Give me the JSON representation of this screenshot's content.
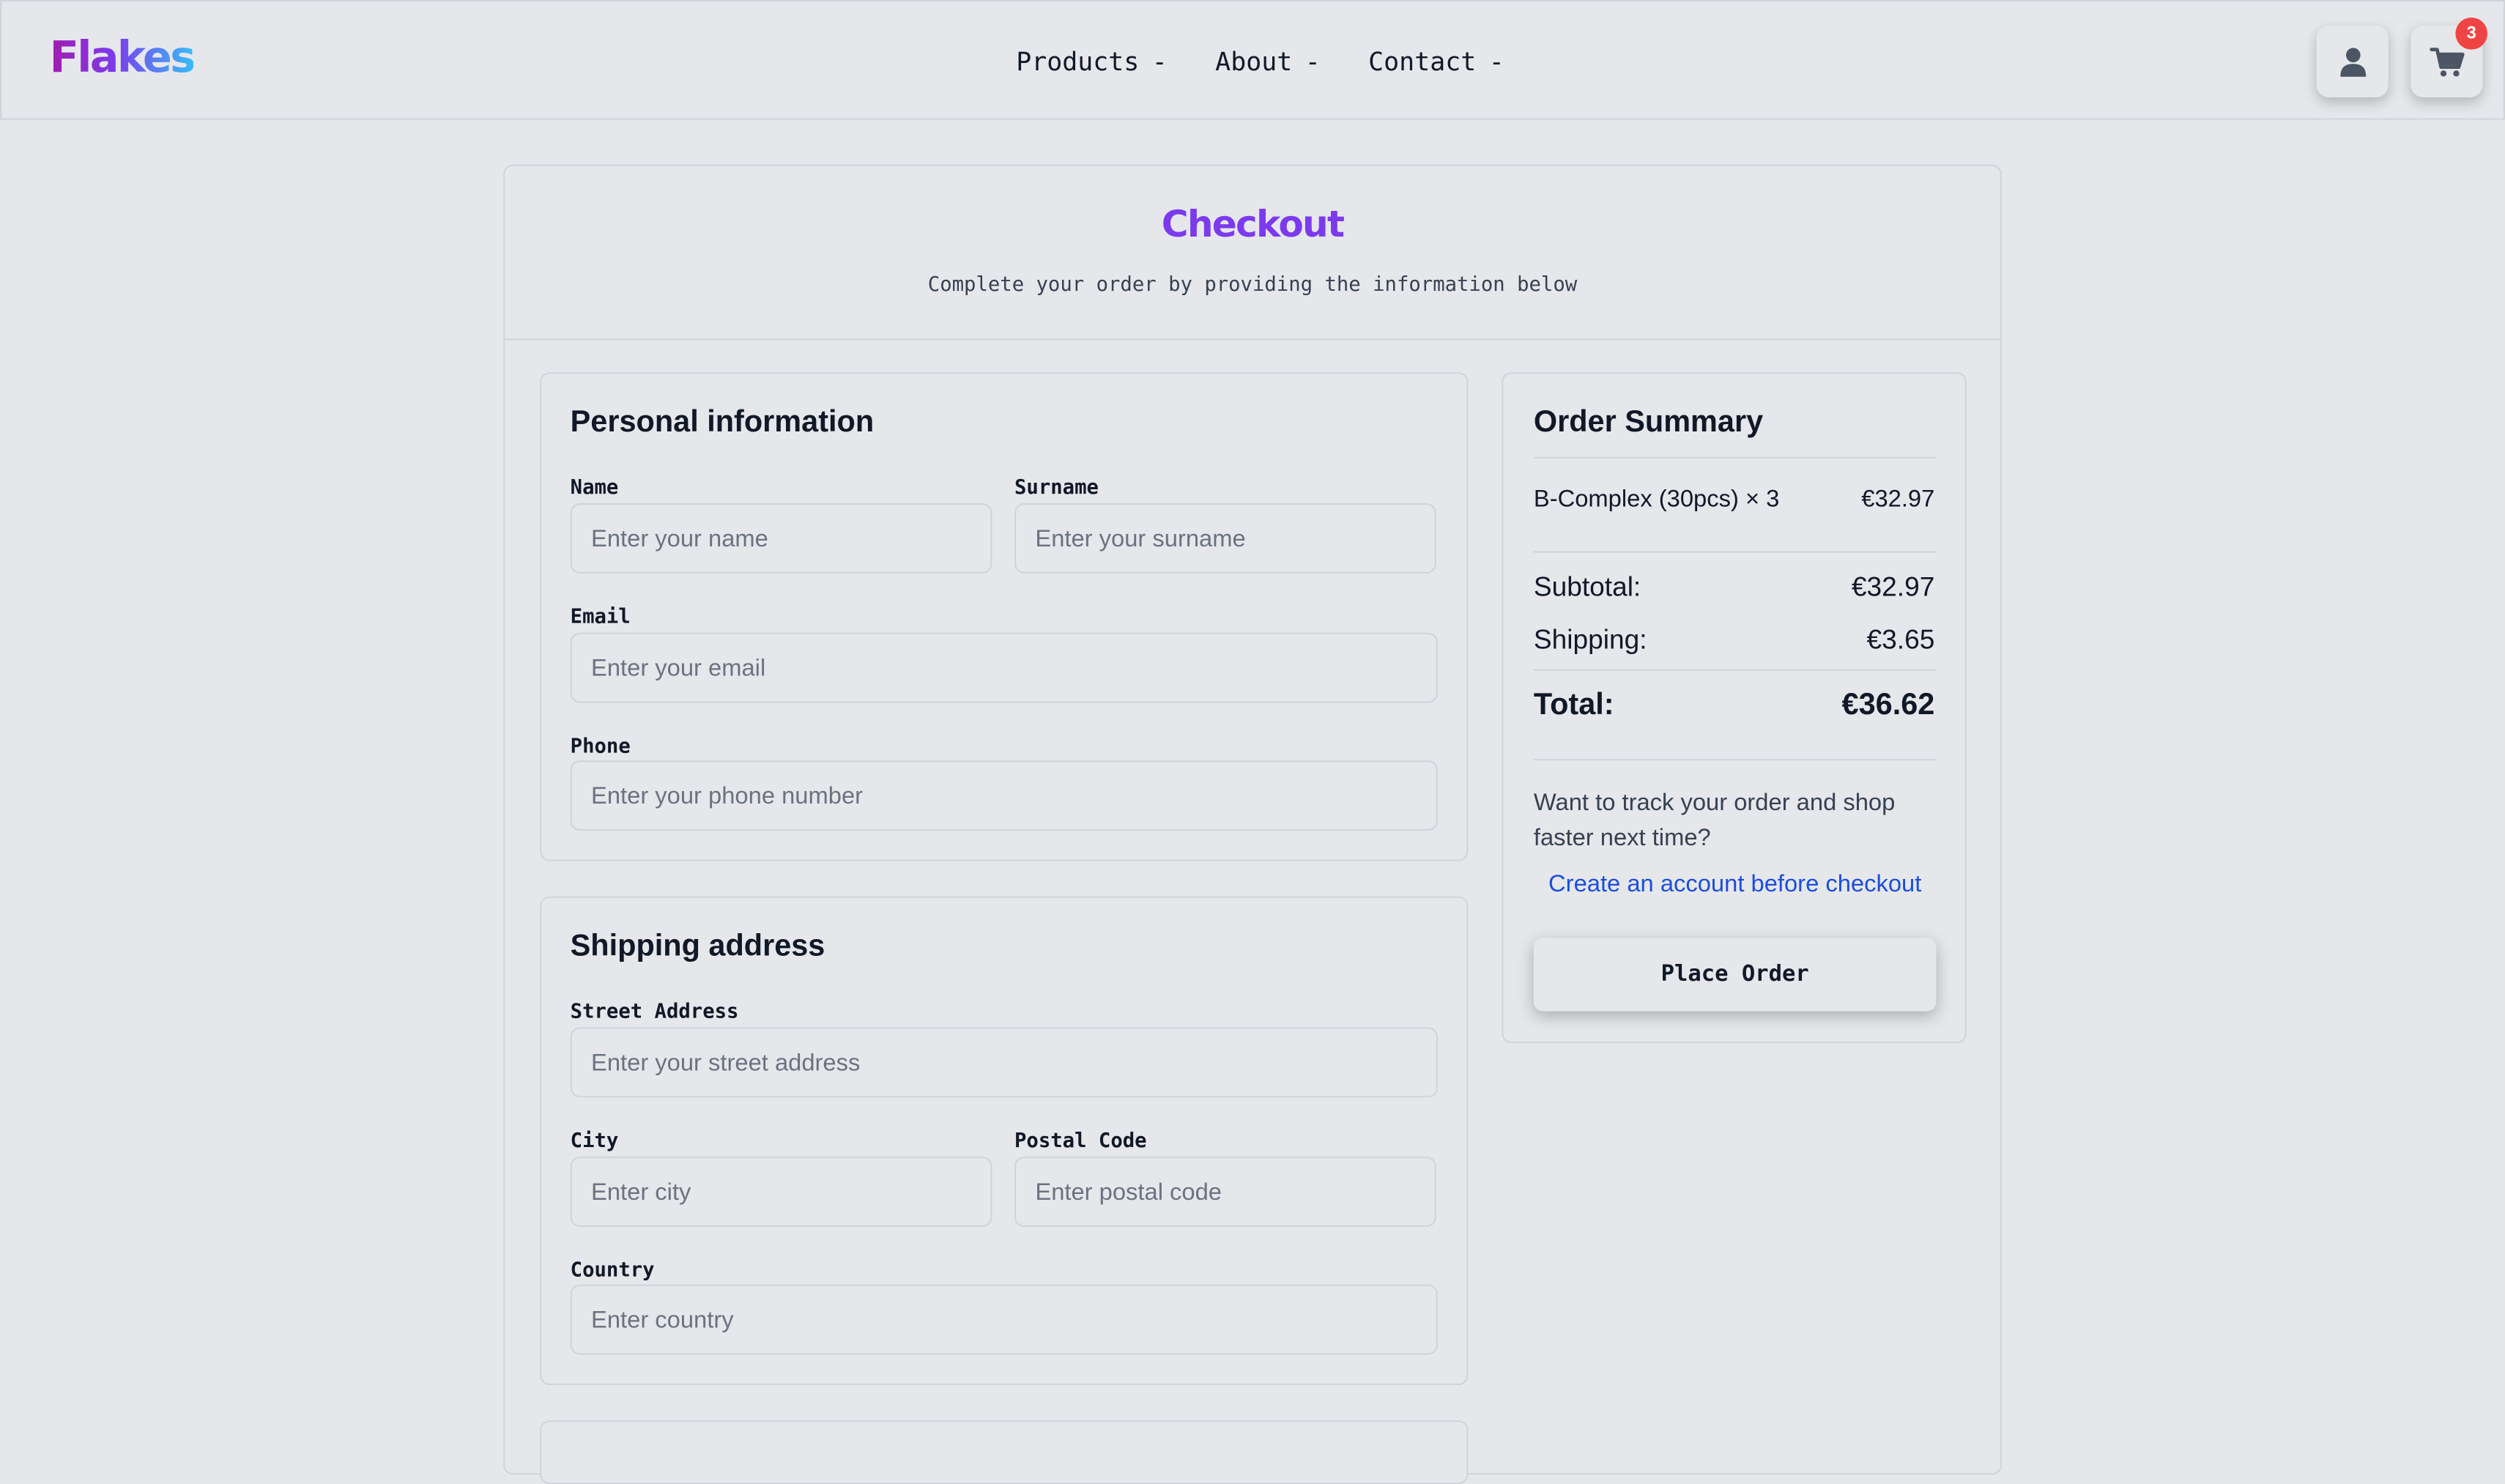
{
  "brand": {
    "logo": "Flakes"
  },
  "nav": {
    "items": [
      {
        "label": "Products",
        "caret": "-"
      },
      {
        "label": "About",
        "caret": "-"
      },
      {
        "label": "Contact",
        "caret": "-"
      }
    ]
  },
  "header_actions": {
    "user_icon": "user-icon",
    "cart_icon": "cart-icon",
    "cart_count": "3"
  },
  "checkout": {
    "title": "Checkout",
    "subtitle": "Complete your order by providing the information below"
  },
  "personal": {
    "title": "Personal information",
    "name_label": "Name",
    "name_placeholder": "Enter your name",
    "surname_label": "Surname",
    "surname_placeholder": "Enter your surname",
    "email_label": "Email",
    "email_placeholder": "Enter your email",
    "phone_label": "Phone",
    "phone_placeholder": "Enter your phone number"
  },
  "shipping": {
    "title": "Shipping address",
    "street_label": "Street Address",
    "street_placeholder": "Enter your street address",
    "city_label": "City",
    "city_placeholder": "Enter city",
    "postal_label": "Postal Code",
    "postal_placeholder": "Enter postal code",
    "country_label": "Country",
    "country_placeholder": "Enter country"
  },
  "summary": {
    "title": "Order Summary",
    "items": [
      {
        "name": "B-Complex (30pcs) × 3",
        "price": "€32.97"
      }
    ],
    "subtotal_label": "Subtotal:",
    "subtotal_value": "€32.97",
    "shipping_label": "Shipping:",
    "shipping_value": "€3.65",
    "total_label": "Total:",
    "total_value": "€36.62",
    "promo_text": "Want to track your order and shop faster next time?",
    "create_account_link": "Create an account before checkout",
    "place_order_button": "Place Order"
  },
  "colors": {
    "background": "#e5e7eb",
    "accent": "#7c3aed",
    "link": "#1d4ed8",
    "badge": "#ef4444"
  }
}
